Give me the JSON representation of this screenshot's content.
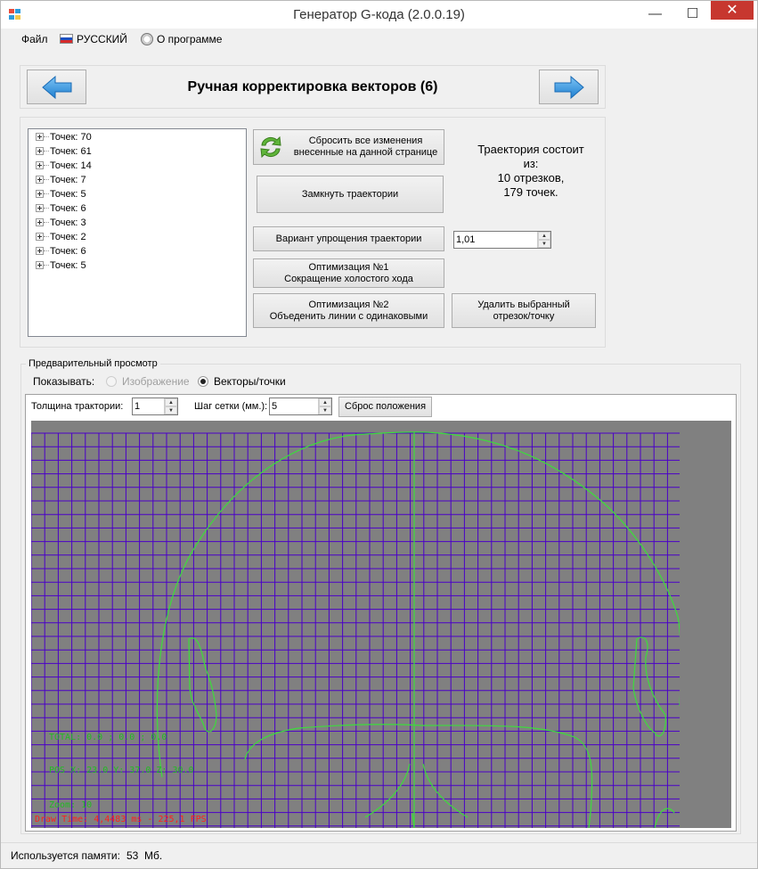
{
  "window": {
    "title": "Генератор G-кода (2.0.0.19)",
    "minimize_glyph": "—",
    "maximize_glyph": "☐",
    "close_glyph": "✕",
    "icon": "app-windows-icon"
  },
  "menu": {
    "file": "Файл",
    "language": "РУССКИЙ",
    "about": "О программе"
  },
  "header": {
    "title": "Ручная корректировка векторов (6)",
    "back_icon": "arrow-left-icon",
    "forward_icon": "arrow-right-icon"
  },
  "tree": {
    "items": [
      {
        "label": "Точек: 70"
      },
      {
        "label": "Точек: 61"
      },
      {
        "label": "Точек: 14"
      },
      {
        "label": "Точек: 7"
      },
      {
        "label": "Точек: 5"
      },
      {
        "label": "Точек: 6"
      },
      {
        "label": "Точек: 3"
      },
      {
        "label": "Точек: 2"
      },
      {
        "label": "Точек: 6"
      },
      {
        "label": "Точек: 5"
      }
    ]
  },
  "actions": {
    "reset_line1": "Сбросить все изменения",
    "reset_line2": "внесенные на данной странице",
    "close_paths": "Замкнуть траектории",
    "simplify": "Вариант упрощения траектории",
    "simplify_value": "1,01",
    "opt1_line1": "Оптимизация №1",
    "opt1_line2": "Сокращение холостого хода",
    "opt2_line1": "Оптимизация №2",
    "opt2_line2": "Объеденить линии с одинаковыми",
    "delete_line1": "Удалить выбранный",
    "delete_line2": "отрезок/точку"
  },
  "info": {
    "line1": "Траектория состоит",
    "line2": "из:",
    "line3": "10 отрезков,",
    "line4": "179 точек."
  },
  "preview": {
    "group_title": "Предварительный просмотр",
    "show_label": "Показывать:",
    "option_image": "Изображение",
    "option_vectors": "Векторы/точки",
    "selected": "Векторы/точки",
    "thickness_label": "Толщина трактории:",
    "thickness_value": "1",
    "grid_label": "Шаг сетки (мм.):",
    "grid_value": "5",
    "reset_position": "Сброс положения",
    "overlay_total": "TOTAL: 0.0 ; 0.0 ; 0.0",
    "overlay_pos": "POS X: 23.0  Y: 37.0  Z: 30.0",
    "overlay_zoom": "Zoom: 10",
    "overlay_draw": "Draw Time:  4,4483 ms  -  225,1 FPS",
    "colors": {
      "background": "#808080",
      "grid": "#4b00c8",
      "paths": "#3cdc3c",
      "overlay_green": "#22bb22",
      "overlay_red": "#ff1e1e"
    }
  },
  "status": {
    "memory_label": "Используется памяти:",
    "memory_value": "53",
    "memory_unit": "Мб."
  }
}
